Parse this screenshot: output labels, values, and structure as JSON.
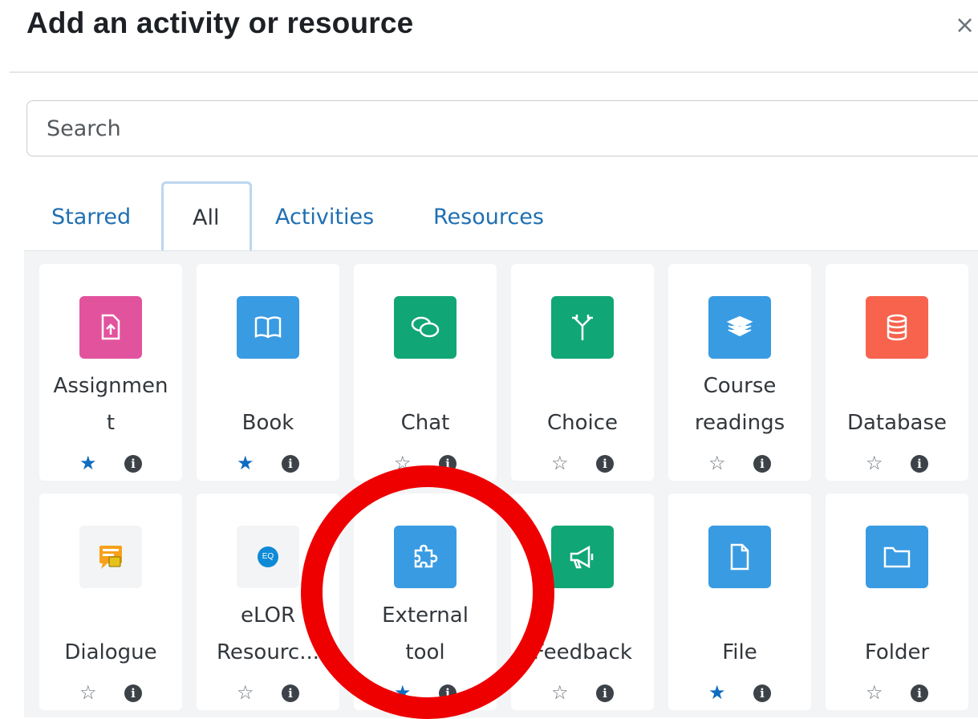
{
  "modal": {
    "title": "Add an activity or resource",
    "close_glyph": "×"
  },
  "search": {
    "placeholder": "Search"
  },
  "tabs": [
    {
      "label": "Starred"
    },
    {
      "label": "All",
      "active": true
    },
    {
      "label": "Activities"
    },
    {
      "label": "Resources"
    }
  ],
  "colors": {
    "assignment": "#e2539e",
    "book": "#399be2",
    "chat": "#11a676",
    "choice": "#11a676",
    "course_readings": "#399be2",
    "database": "#f7634d",
    "external_tool": "#399be2",
    "feedback": "#11a676",
    "file": "#399be2",
    "folder": "#399be2",
    "star_filled": "#0f6cbf",
    "annotation": "#ee0000"
  },
  "items": [
    {
      "label_l1": "Assignmen",
      "label_l2": "t",
      "icon": "assignment-icon",
      "starred": true,
      "star": "★",
      "info": "i"
    },
    {
      "label_l1": "",
      "label_l2": "Book",
      "icon": "book-icon",
      "starred": true,
      "star": "★",
      "info": "i"
    },
    {
      "label_l1": "",
      "label_l2": "Chat",
      "icon": "chat-icon",
      "starred": false,
      "star": "☆",
      "info": "i"
    },
    {
      "label_l1": "",
      "label_l2": "Choice",
      "icon": "choice-icon",
      "starred": false,
      "star": "☆",
      "info": "i"
    },
    {
      "label_l1": "Course",
      "label_l2": "readings",
      "icon": "course-readings-icon",
      "starred": false,
      "star": "☆",
      "info": "i"
    },
    {
      "label_l1": "",
      "label_l2": "Database",
      "icon": "database-icon",
      "starred": false,
      "star": "☆",
      "info": "i"
    },
    {
      "label_l1": "",
      "label_l2": "Dialogue",
      "icon": "dialogue-icon",
      "starred": false,
      "star": "☆",
      "info": "i"
    },
    {
      "label_l1": "eLOR",
      "label_l2": "Resourc...",
      "icon": "elor-icon",
      "icon_text": "EQ",
      "starred": false,
      "star": "☆",
      "info": "i"
    },
    {
      "label_l1": "External",
      "label_l2": "tool",
      "icon": "puzzle-icon",
      "starred": true,
      "star": "★",
      "info": "i"
    },
    {
      "label_l1": "",
      "label_l2": "Feedback",
      "icon": "megaphone-icon",
      "starred": false,
      "star": "☆",
      "info": "i"
    },
    {
      "label_l1": "",
      "label_l2": "File",
      "icon": "file-icon",
      "starred": true,
      "star": "★",
      "info": "i"
    },
    {
      "label_l1": "",
      "label_l2": "Folder",
      "icon": "folder-icon",
      "starred": false,
      "star": "☆",
      "info": "i"
    }
  ]
}
